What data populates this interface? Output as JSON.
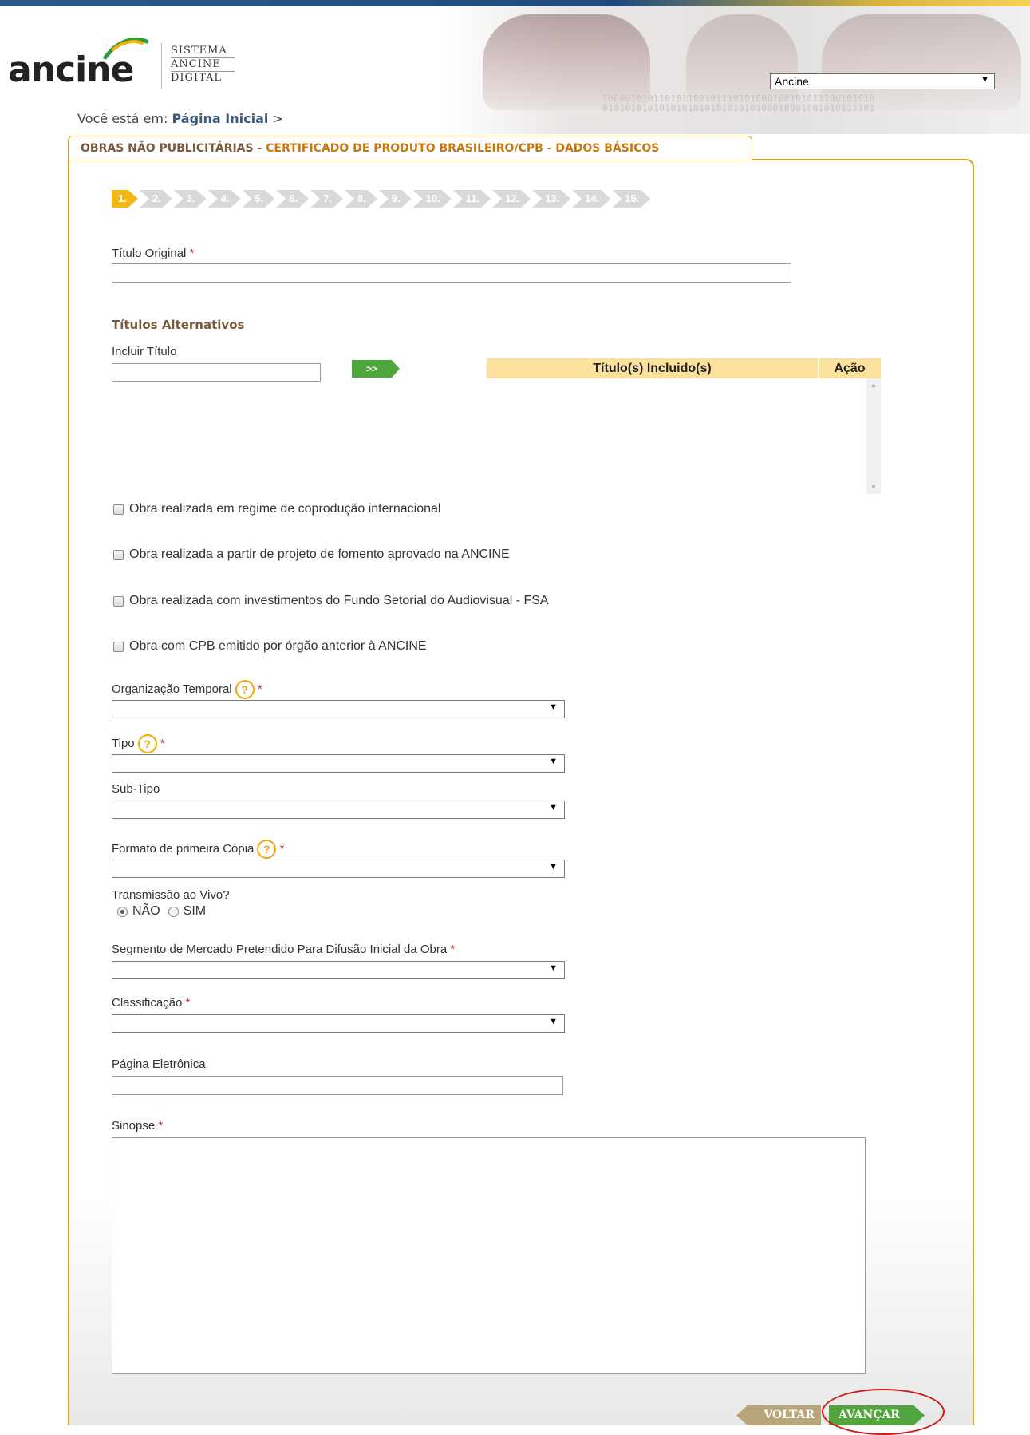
{
  "header": {
    "logo_word": "ancine",
    "logo_sys": [
      "SISTEMA",
      "ANCINE",
      "DIGITAL"
    ],
    "org_select_value": "Ancine",
    "binary_text": "100001010110101100101110101000100101011100101010\n010101010101010101010101010100010001001010111101"
  },
  "breadcrumb": {
    "prefix": "Você está em:",
    "link": "Página Inicial",
    "suffix": ">"
  },
  "panel": {
    "title_part1": "OBRAS NÃO PUBLICITÁRIAS - ",
    "title_part2": "CERTIFICADO DE PRODUTO BRASILEIRO/CPB - DADOS BÁSICOS"
  },
  "steps": [
    "1.",
    "2.",
    "3.",
    "4.",
    "5.",
    "6.",
    "7.",
    "8.",
    "9.",
    "10.",
    "11.",
    "12.",
    "13.",
    "14.",
    "15."
  ],
  "form": {
    "titulo_original_label": "Título Original",
    "required_mark": "*",
    "titulos_alternativos_heading": "Títulos Alternativos",
    "incluir_titulo_label": "Incluir Título",
    "add_button_label": ">>",
    "table_col_titles": "Título(s) Incluido(s)",
    "table_col_action": "Ação",
    "checkboxes": [
      "Obra realizada em regime de coprodução internacional",
      "Obra realizada a partir de projeto de fomento aprovado na ANCINE",
      "Obra realizada com investimentos do Fundo Setorial do Audiovisual - FSA",
      "Obra com CPB emitido por órgão anterior à ANCINE"
    ],
    "organizacao_temporal_label": "Organização Temporal",
    "tipo_label": "Tipo",
    "subtipo_label": "Sub-Tipo",
    "formato_label": "Formato de primeira Cópia",
    "transmissao_label": "Transmissão ao Vivo?",
    "radio_nao": "NÃO",
    "radio_sim": "SIM",
    "segmento_label": "Segmento de Mercado Pretendido Para Difusão Inicial da Obra",
    "classificacao_label": "Classificação",
    "pagina_label": "Página Eletrônica",
    "sinopse_label": "Sinopse",
    "help_glyph": "?"
  },
  "buttons": {
    "voltar": "VOLTAR",
    "avancar": "AVANÇAR"
  },
  "colors": {
    "accent_gold": "#d8a520",
    "step_active": "#f3b71a",
    "go_green": "#52a43d",
    "back_tan": "#b9a57a",
    "highlight_red": "#d01818"
  }
}
